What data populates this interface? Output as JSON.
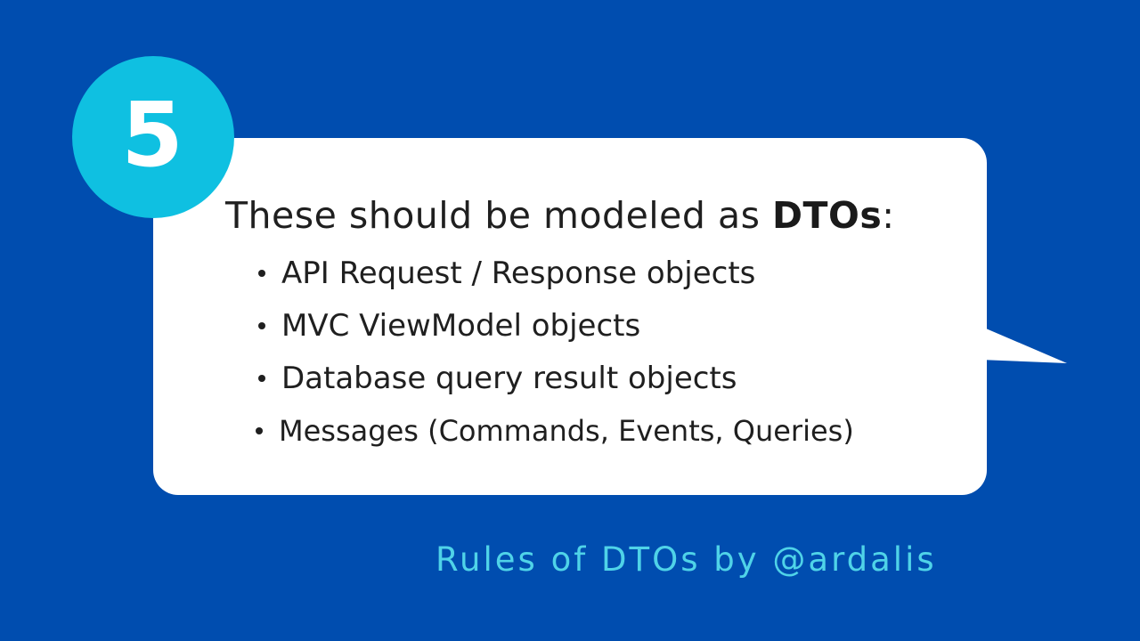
{
  "slide": {
    "number": "5",
    "headline_prefix": "These should be modeled as ",
    "headline_bold": "DTOs",
    "headline_suffix": ":",
    "items": [
      "API Request / Response objects",
      "MVC ViewModel objects",
      "Database query result objects",
      "Messages (Commands, Events, Queries)"
    ],
    "footer": "Rules of DTOs by @ardalis"
  },
  "colors": {
    "background": "#004DAF",
    "bubble": "#FFFFFF",
    "number_circle": "#0FC0E1",
    "footer_text": "#4FD3E8",
    "body_text": "#1F1F1F"
  }
}
